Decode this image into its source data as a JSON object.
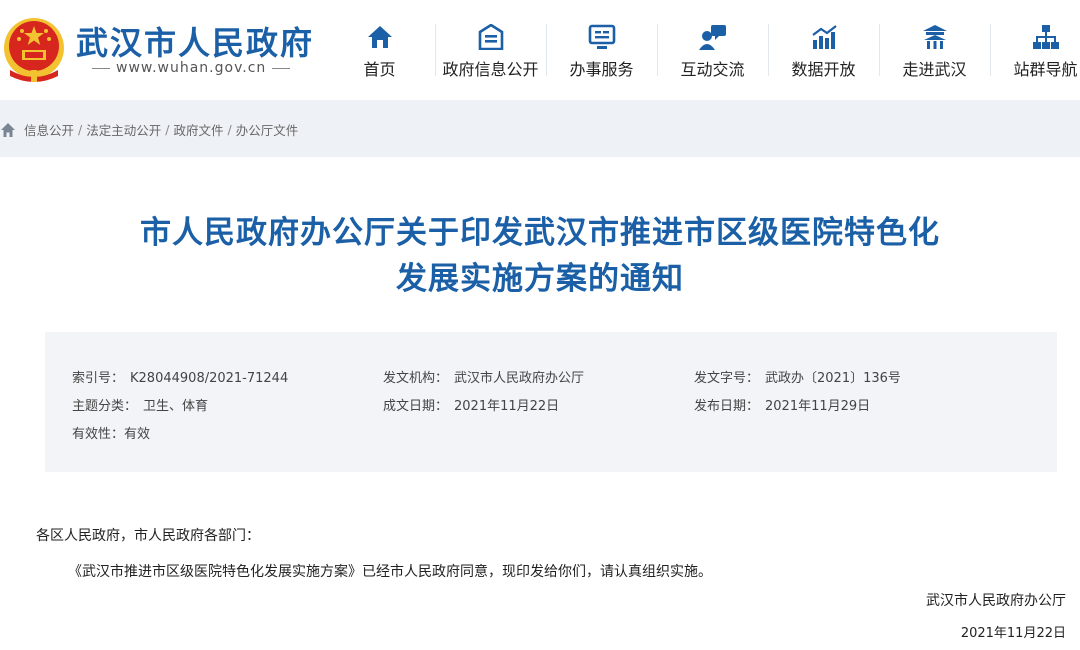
{
  "header": {
    "site_name": "武汉市人民政府",
    "site_url": "www.wuhan.gov.cn",
    "nav": [
      {
        "label": "首页",
        "icon": "home-icon"
      },
      {
        "label": "政府信息公开",
        "icon": "document-icon"
      },
      {
        "label": "办事服务",
        "icon": "monitor-icon"
      },
      {
        "label": "互动交流",
        "icon": "chat-user-icon"
      },
      {
        "label": "数据开放",
        "icon": "chart-icon"
      },
      {
        "label": "走进武汉",
        "icon": "pavilion-icon"
      },
      {
        "label": "站群导航",
        "icon": "sitemap-icon"
      }
    ]
  },
  "breadcrumb": [
    "信息公开",
    "法定主动公开",
    "政府文件",
    "办公厅文件"
  ],
  "title": {
    "line1": "市人民政府办公厅关于印发武汉市推进市区级医院特色化",
    "line2": "发展实施方案的通知"
  },
  "meta": {
    "index_label": "索引号：",
    "index_value": "K28044908/2021-71244",
    "topic_label": "主题分类：",
    "topic_value": "卫生、体育",
    "validity_label": "有效性：",
    "validity_value": "有效",
    "issuer_label": "发文机构：",
    "issuer_value": "武汉市人民政府办公厅",
    "written_label": "成文日期：",
    "written_value": "2021年11月22日",
    "docno_label": "发文字号：",
    "docno_value": "武政办〔2021〕136号",
    "publish_label": "发布日期：",
    "publish_value": "2021年11月29日"
  },
  "body": {
    "salutation": "各区人民政府，市人民政府各部门：",
    "paragraph": "《武汉市推进市区级医院特色化发展实施方案》已经市人民政府同意，现印发给你们，请认真组织实施。",
    "signature": "武汉市人民政府办公厅",
    "date": "2021年11月22日"
  },
  "colors": {
    "brand": "#1b5fa6",
    "emblem_red": "#d7261e",
    "emblem_gold": "#f2c230",
    "breadcrumb_bg": "#eef2f7",
    "meta_bg": "#f2f4f7"
  }
}
